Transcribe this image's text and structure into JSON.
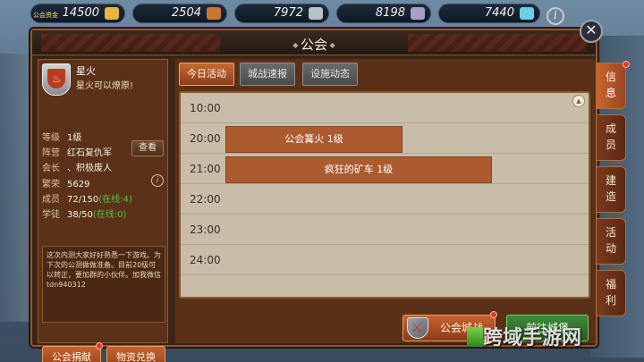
{
  "resources": [
    {
      "label": "公会资金",
      "value": "14500",
      "icon": "gold-bars-icon",
      "color": "#e8b63a"
    },
    {
      "label": "",
      "value": "2504",
      "icon": "wood-icon",
      "color": "#c8782e"
    },
    {
      "label": "",
      "value": "7972",
      "icon": "stone-icon",
      "color": "#b8c0c8"
    },
    {
      "label": "",
      "value": "8198",
      "icon": "iron-icon",
      "color": "#a8a0c8"
    },
    {
      "label": "",
      "value": "7440",
      "icon": "crystal-icon",
      "color": "#6ad0e8"
    }
  ],
  "panel": {
    "title": "公会"
  },
  "guild": {
    "name": "星火",
    "slogan": "星火可以燎原!",
    "rows": [
      {
        "key": "等级",
        "value": "1级",
        "extra": ""
      },
      {
        "key": "阵营",
        "value": "红石复仇军",
        "extra": ""
      },
      {
        "key": "会长",
        "value": "、积极废人",
        "extra": ""
      },
      {
        "key": "繁荣",
        "value": "5629",
        "extra": ""
      },
      {
        "key": "成员",
        "value": "72/150",
        "extra": "(在线:4)"
      },
      {
        "key": "学徒",
        "value": "38/50",
        "extra": "(在线:0)"
      }
    ],
    "view_label": "查看",
    "notice": "这次内测大家好好熟悉一下游戏。为下次的公测做做准备。目前20级可以转正，要加群的小伙伴。加我微信tdn940312"
  },
  "left_buttons": {
    "donate": "公会捐献",
    "exchange": "物资兑换"
  },
  "tabs": [
    "今日活动",
    "城战速报",
    "设施动态"
  ],
  "schedule": {
    "times": [
      "10:00",
      "20:00",
      "21:00",
      "22:00",
      "23:00",
      "24:00"
    ],
    "events": [
      {
        "label": "公会篝火 1级",
        "start": "20:00"
      },
      {
        "label": "疯狂的矿车 1级",
        "start": "21:00"
      }
    ]
  },
  "bottom_buttons": {
    "guild_war": "公会城战",
    "goto_castle": "前往城堡"
  },
  "side_tabs": [
    "信息",
    "成员",
    "建造",
    "活动",
    "福利"
  ],
  "watermark": "跨域手游网",
  "colors": {
    "accent_orange": "#c8632e",
    "online_green": "#55c24a",
    "schedule_bg": "#c7bda8"
  }
}
